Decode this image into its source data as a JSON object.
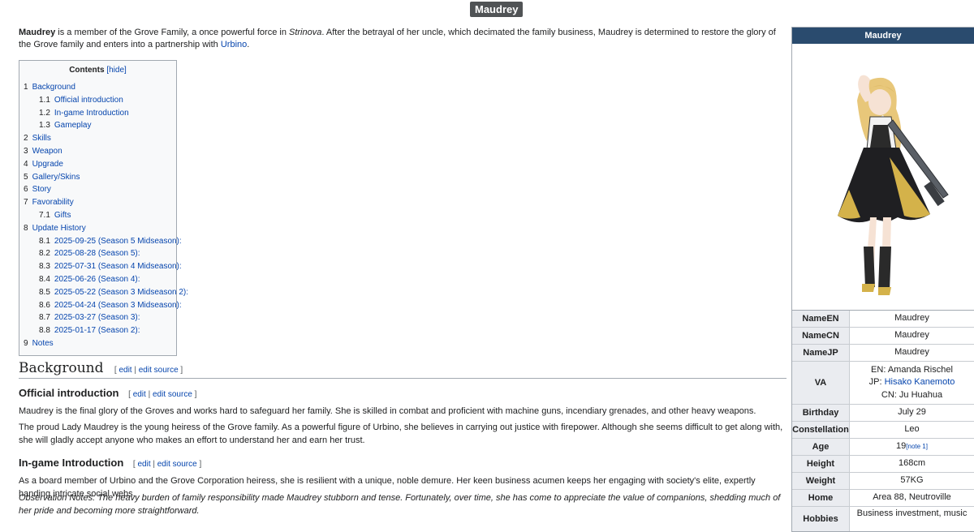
{
  "page_title": "Maudrey",
  "intro": {
    "bold_name": "Maudrey",
    "text1": " is a member of the Grove Family, a once powerful force in ",
    "game": "Strinova",
    "text2": ". After the betrayal of her uncle, which decimated the family business, Maudrey is determined to restore the glory of the Grove family and enters into a partnership with ",
    "partner": "Urbino",
    "text3": "."
  },
  "toc": {
    "title": "Contents",
    "hide": "[hide]",
    "items": [
      {
        "num": "1",
        "label": "Background",
        "level": 1
      },
      {
        "num": "1.1",
        "label": "Official introduction",
        "level": 2
      },
      {
        "num": "1.2",
        "label": "In-game Introduction",
        "level": 2
      },
      {
        "num": "1.3",
        "label": "Gameplay",
        "level": 2
      },
      {
        "num": "2",
        "label": "Skills",
        "level": 1
      },
      {
        "num": "3",
        "label": "Weapon",
        "level": 1
      },
      {
        "num": "4",
        "label": "Upgrade",
        "level": 1
      },
      {
        "num": "5",
        "label": "Gallery/Skins",
        "level": 1
      },
      {
        "num": "6",
        "label": "Story",
        "level": 1
      },
      {
        "num": "7",
        "label": "Favorability",
        "level": 1
      },
      {
        "num": "7.1",
        "label": "Gifts",
        "level": 2
      },
      {
        "num": "8",
        "label": "Update History",
        "level": 1
      },
      {
        "num": "8.1",
        "label": "2025-09-25 (Season 5 Midseason):",
        "level": 2
      },
      {
        "num": "8.2",
        "label": "2025-08-28 (Season 5):",
        "level": 2
      },
      {
        "num": "8.3",
        "label": "2025-07-31 (Season 4 Midseason):",
        "level": 2
      },
      {
        "num": "8.4",
        "label": "2025-06-26 (Season 4):",
        "level": 2
      },
      {
        "num": "8.5",
        "label": "2025-05-22 (Season 3 Midseason 2):",
        "level": 2
      },
      {
        "num": "8.6",
        "label": "2025-04-24 (Season 3 Midseason):",
        "level": 2
      },
      {
        "num": "8.7",
        "label": "2025-03-27 (Season 3):",
        "level": 2
      },
      {
        "num": "8.8",
        "label": "2025-01-17 (Season 2):",
        "level": 2
      },
      {
        "num": "9",
        "label": "Notes",
        "level": 1
      }
    ]
  },
  "edit": {
    "open": "[ ",
    "edit": "edit",
    "sep": " | ",
    "edit_source": "edit source",
    "close": " ]"
  },
  "background": {
    "heading": "Background",
    "official_heading": "Official introduction",
    "official_p1": "Maudrey is the final glory of the Groves and works hard to safeguard her family. She is skilled in combat and proficient with machine guns, incendiary grenades, and other heavy weapons.",
    "official_p2": "The proud Lady Maudrey is the young heiress of the Grove family. As a powerful figure of Urbino, she believes in carrying out justice with firepower. Although she seems difficult to get along with, she will gladly accept anyone who makes an effort to understand her and earn her trust.",
    "ingame_heading": "In-game Introduction",
    "ingame_p1": "As a board member of Urbino and the Grove Corporation heiress, she is resilient with a unique, noble demure. Her keen business acumen keeps her engaging with society's elite, expertly handing intricate social webs.",
    "ingame_p2": "Observation Notes: The heavy burden of family responsibility made Maudrey stubborn and tense. Fortunately, over time, she has come to appreciate the value of companions, shedding much of her pride and becoming more straightforward."
  },
  "infobox": {
    "title": "Maudrey",
    "rows": {
      "name_en": {
        "k": "NameEN",
        "v": "Maudrey"
      },
      "name_cn": {
        "k": "NameCN",
        "v": "Maudrey"
      },
      "name_jp": {
        "k": "NameJP",
        "v": "Maudrey"
      },
      "va": {
        "k": "VA",
        "en": "EN: Amanda Rischel",
        "jp_prefix": "JP: ",
        "jp_link": "Hisako Kanemoto",
        "cn": "CN: Ju Huahua"
      },
      "birthday": {
        "k": "Birthday",
        "v": "July 29"
      },
      "constellation": {
        "k": "Constellation",
        "v": "Leo"
      },
      "age": {
        "k": "Age",
        "v": "19",
        "note": "[note 1]"
      },
      "height": {
        "k": "Height",
        "v": "168cm"
      },
      "weight": {
        "k": "Weight",
        "v": "57KG"
      },
      "home": {
        "k": "Home",
        "v": "Area 88, Neutroville"
      },
      "hobbies": {
        "k": "Hobbies",
        "v": "Business investment, music"
      }
    }
  },
  "colors": {
    "link": "#0645ad",
    "infobox_header": "#2a4b6e",
    "title_badge": "#505355"
  }
}
